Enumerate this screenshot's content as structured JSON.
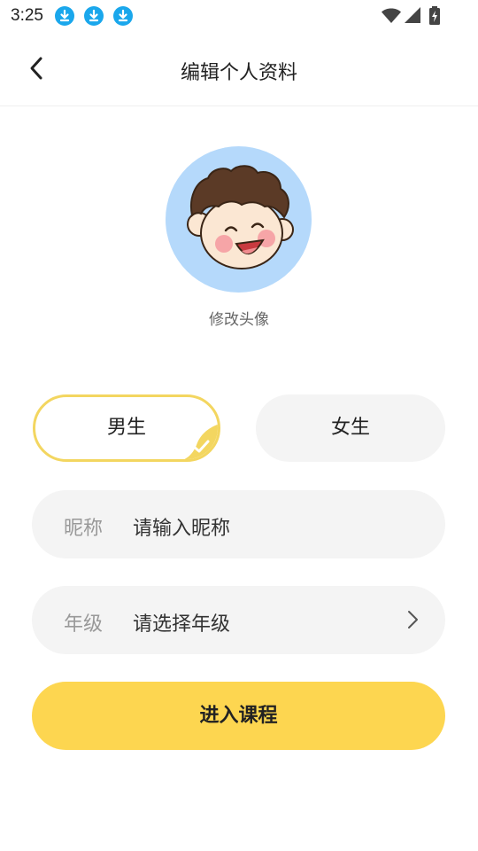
{
  "status_bar": {
    "time": "3:25",
    "icons": [
      "download-icon",
      "download-icon",
      "download-icon",
      "wifi-icon",
      "cellular-signal-icon",
      "battery-charging-icon"
    ],
    "download_icon_color": "#1aa7ec"
  },
  "header": {
    "title": "编辑个人资料",
    "back_icon": "chevron-left-icon"
  },
  "avatar": {
    "caption": "修改头像",
    "background_color": "#b5d9fb"
  },
  "gender": {
    "options": [
      {
        "label": "男生",
        "selected": true
      },
      {
        "label": "女生",
        "selected": false
      }
    ],
    "selected_accent": "#f3d660"
  },
  "form": {
    "nickname": {
      "label": "昵称",
      "placeholder": "请输入昵称"
    },
    "grade": {
      "label": "年级",
      "placeholder": "请选择年级",
      "icon": "chevron-right-icon"
    }
  },
  "submit": {
    "label": "进入课程",
    "color": "#fdd650"
  }
}
